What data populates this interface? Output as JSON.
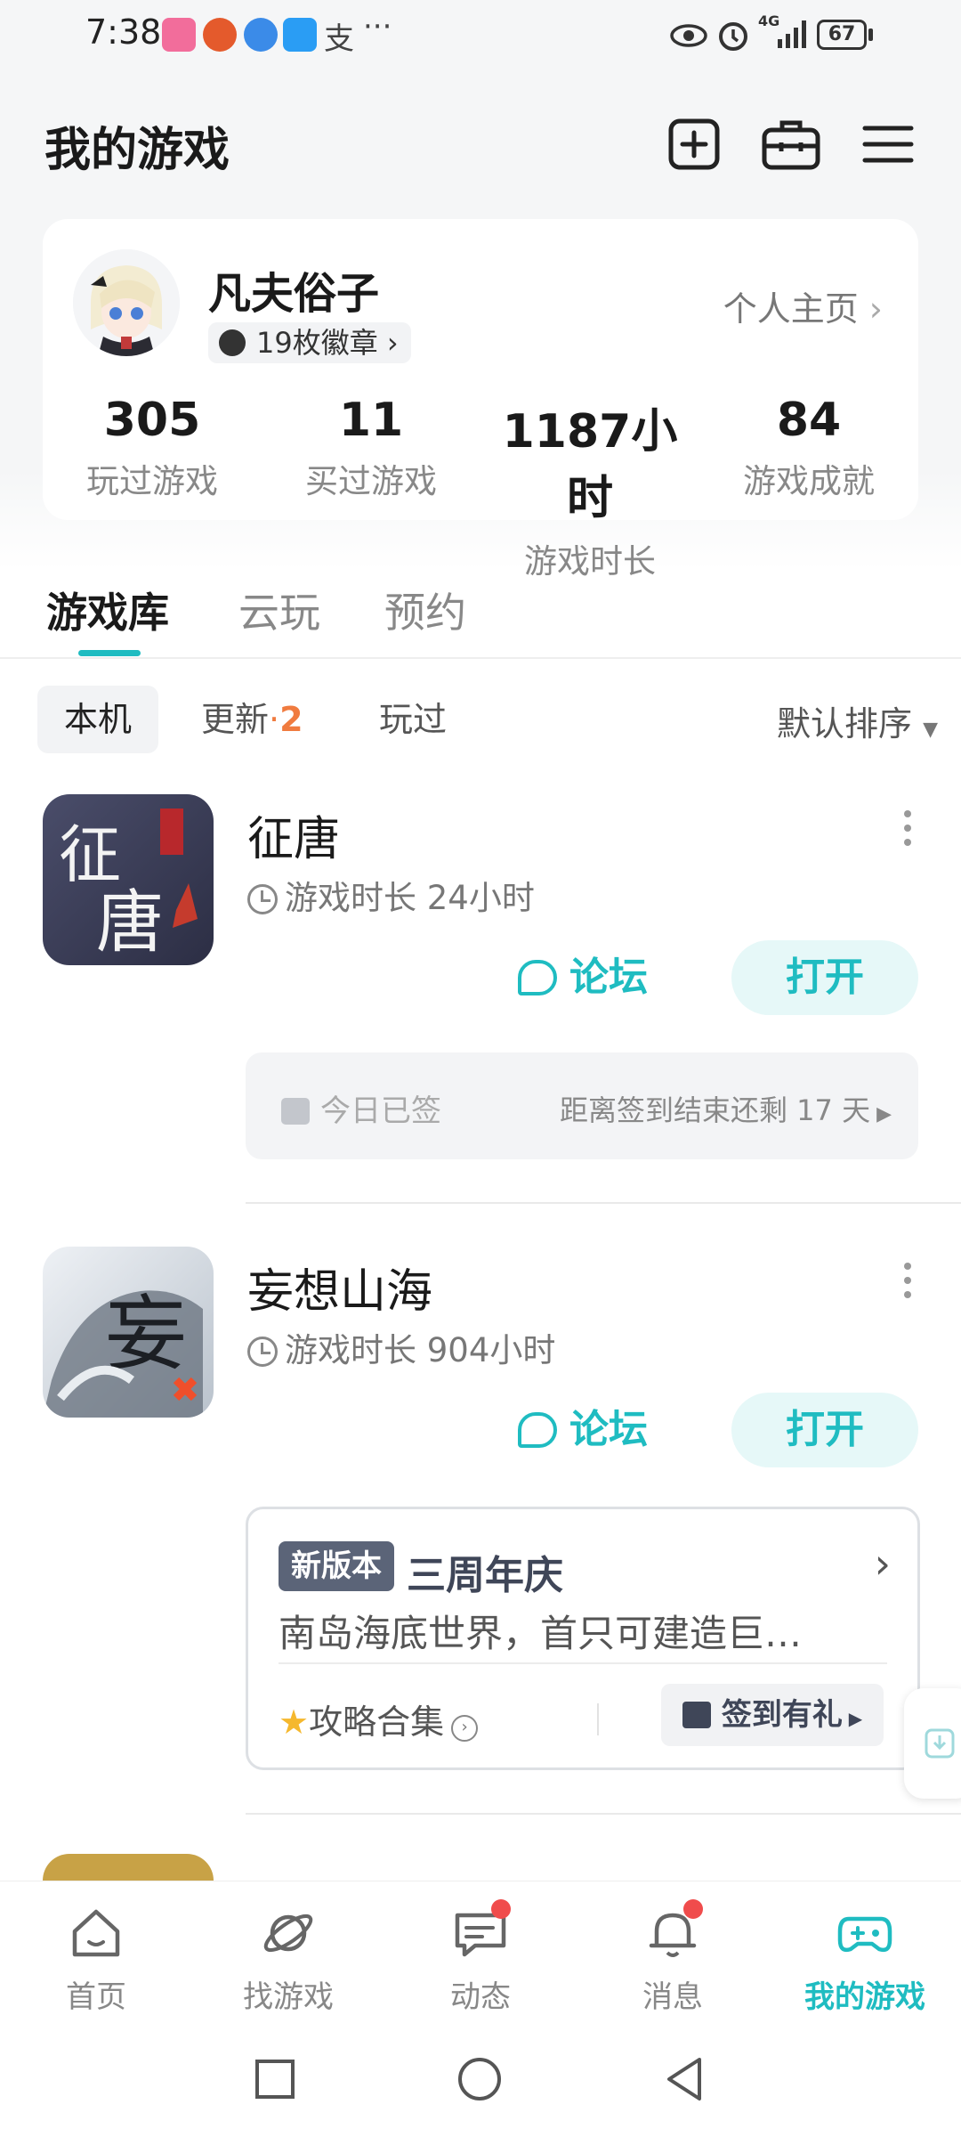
{
  "status_bar": {
    "time": "7:38",
    "battery": "67",
    "network": "4G"
  },
  "header": {
    "title": "我的游戏"
  },
  "profile": {
    "username": "凡夫俗子",
    "badges": "19枚徽章",
    "profile_link": "个人主页",
    "stats": [
      {
        "value": "305",
        "label": "玩过游戏"
      },
      {
        "value": "11",
        "label": "买过游戏"
      },
      {
        "value": "1187小时",
        "label": "游戏时长"
      },
      {
        "value": "84",
        "label": "游戏成就"
      }
    ]
  },
  "tabs": [
    {
      "label": "游戏库"
    },
    {
      "label": "云玩"
    },
    {
      "label": "预约"
    }
  ],
  "filters": {
    "local": "本机",
    "update": "更新",
    "update_count": "2",
    "played": "玩过",
    "sort": "默认排序"
  },
  "games": [
    {
      "name": "征唐",
      "playtime": "游戏时长 24小时",
      "forum": "论坛",
      "open": "打开",
      "signin_status": "今日已签",
      "signin_remaining": "距离签到结束还剩 17 天"
    },
    {
      "name": "妄想山海",
      "playtime": "游戏时长 904小时",
      "forum": "论坛",
      "open": "打开",
      "news_tag": "新版本",
      "news_title": "三周年庆",
      "news_desc": "南岛海底世界，首只可建造巨…",
      "guide": "攻略合集",
      "gift": "签到有礼"
    }
  ],
  "bottom_nav": [
    {
      "label": "首页",
      "icon": "home-icon"
    },
    {
      "label": "找游戏",
      "icon": "planet-icon"
    },
    {
      "label": "动态",
      "icon": "chat-icon"
    },
    {
      "label": "消息",
      "icon": "bell-icon"
    },
    {
      "label": "我的游戏",
      "icon": "gamepad-icon"
    }
  ],
  "colors": {
    "accent": "#1fbcc1",
    "badge_orange": "#f07b3f",
    "notification": "#f04c4c"
  }
}
